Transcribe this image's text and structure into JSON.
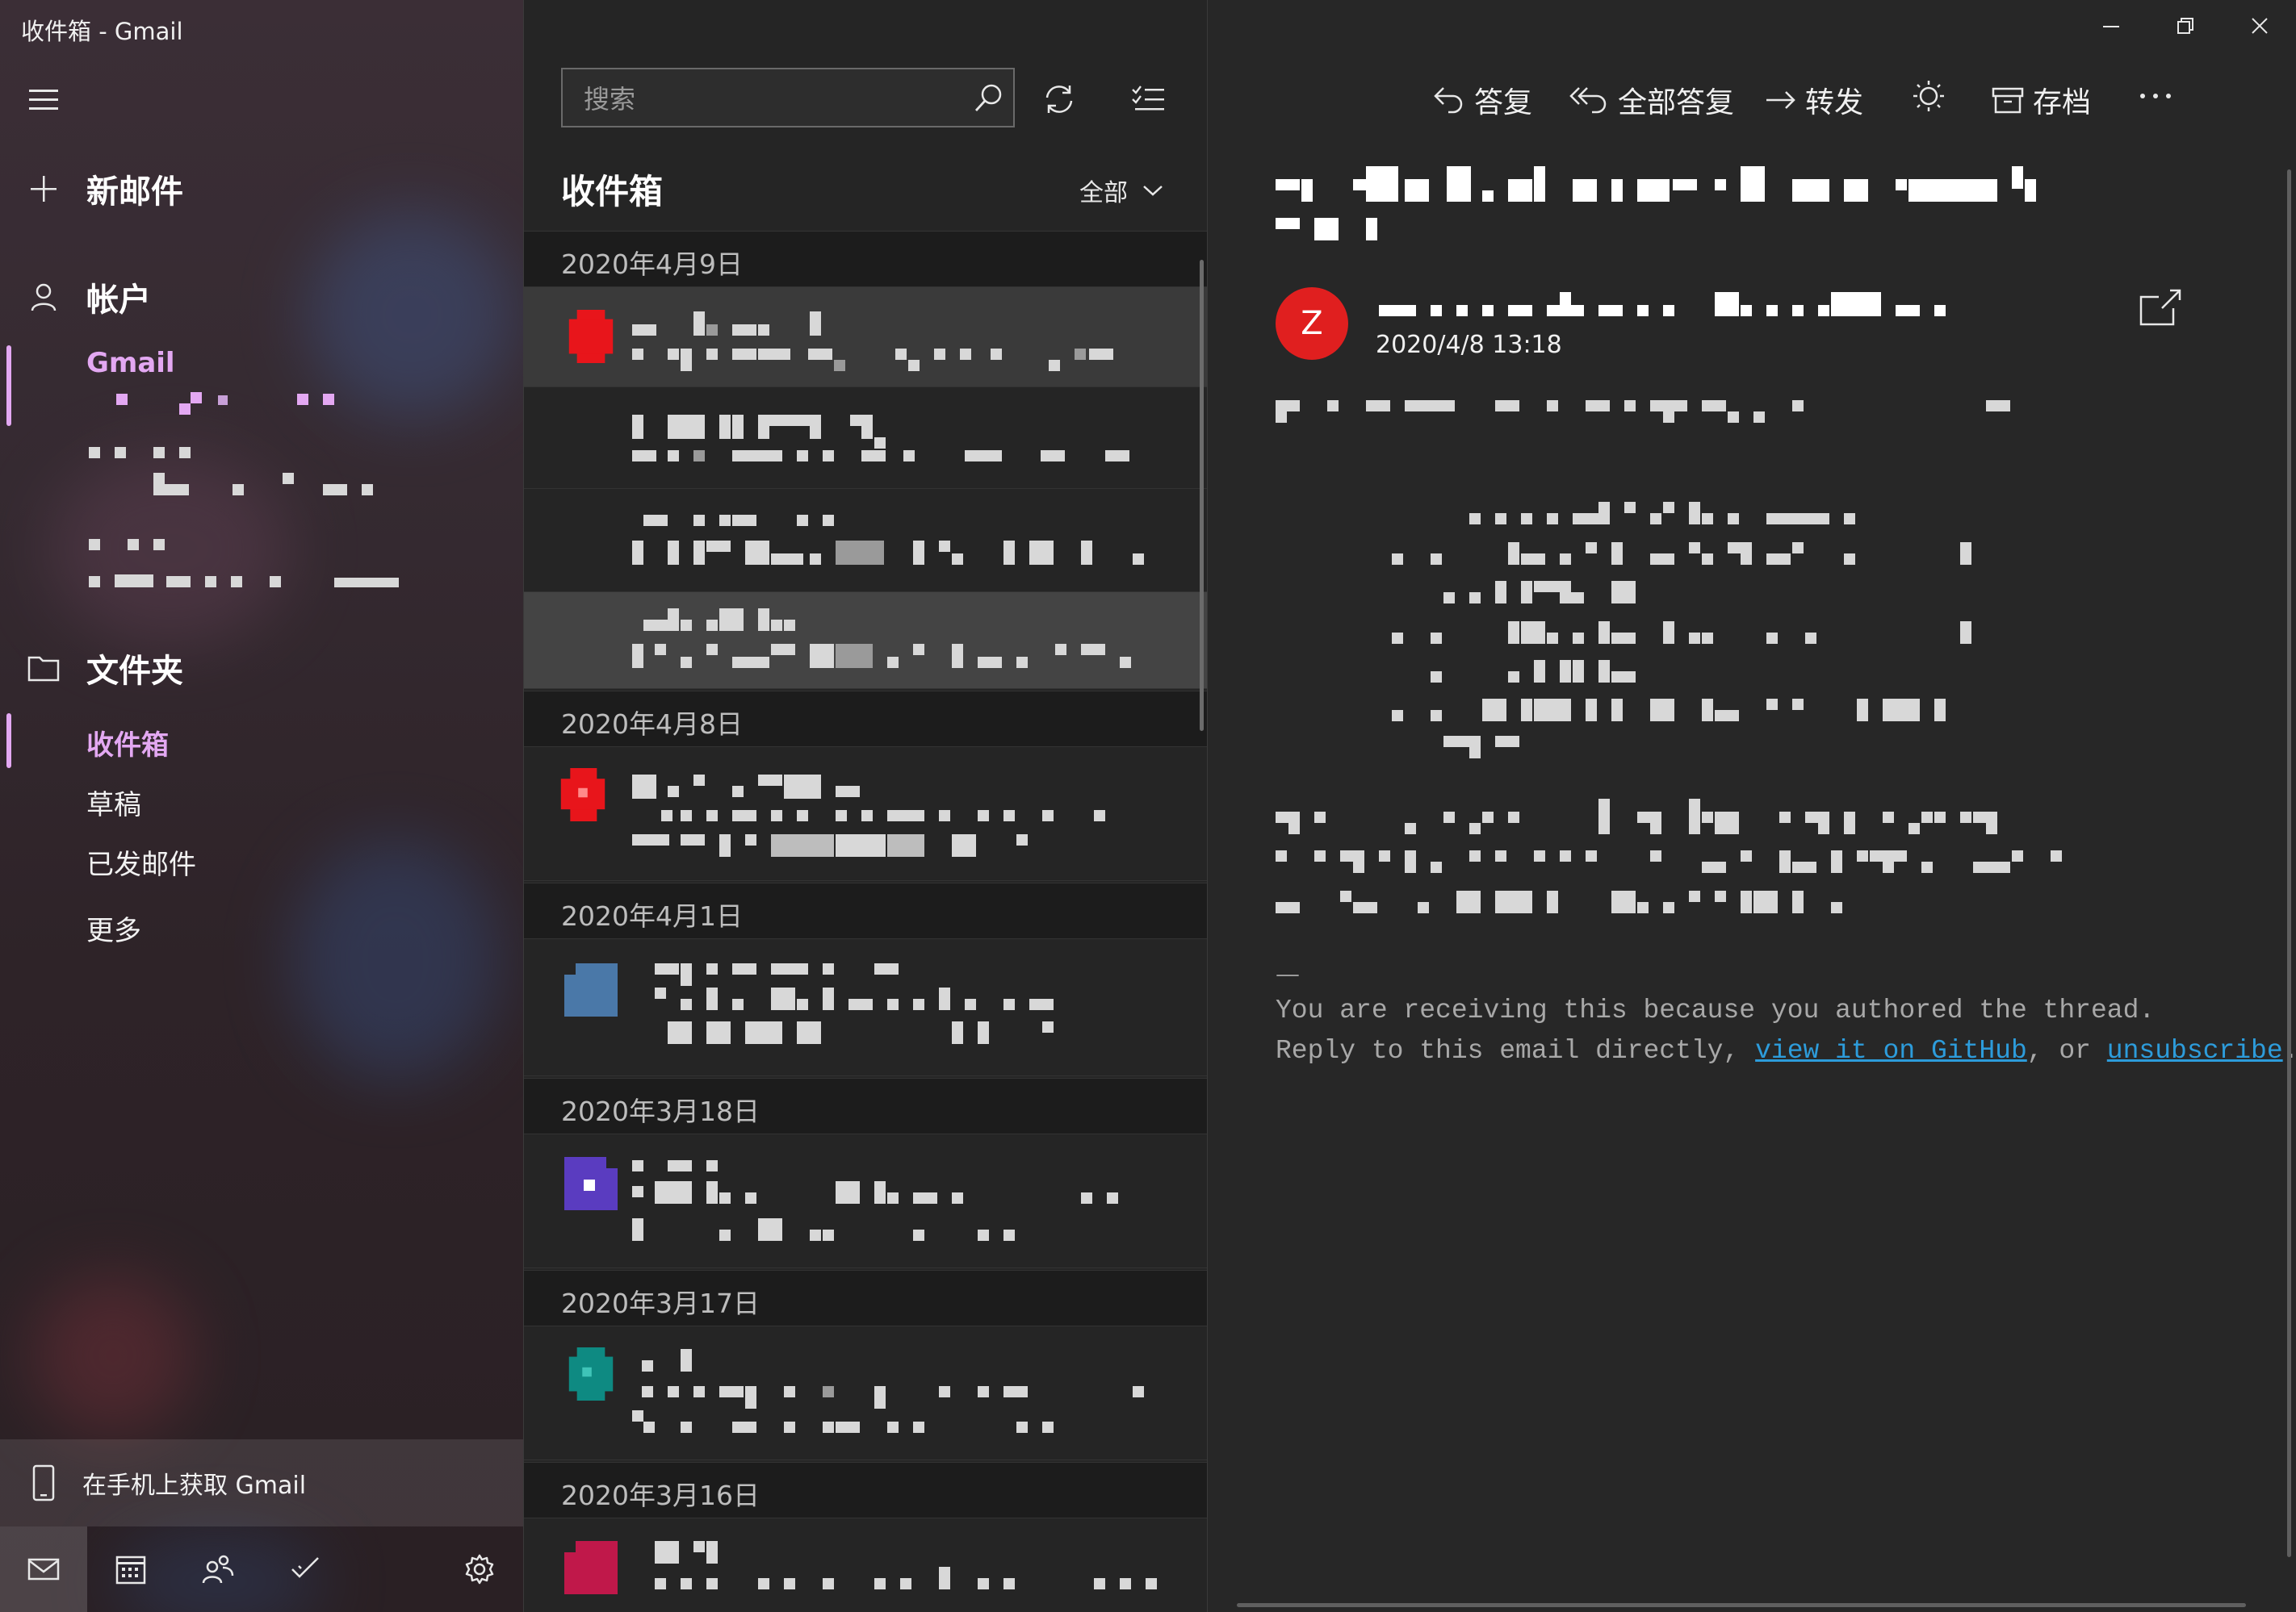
{
  "window": {
    "title": "收件箱 - Gmail"
  },
  "nav": {
    "new_mail": "新邮件",
    "accounts_header": "帐户",
    "account_name": "Gmail",
    "folders_header": "文件夹",
    "folders": [
      {
        "label": "收件箱",
        "active": true
      },
      {
        "label": "草稿",
        "active": false
      },
      {
        "label": "已发邮件",
        "active": false
      },
      {
        "label": "更多",
        "active": false
      }
    ],
    "promo": "在手机上获取 Gmail",
    "accent_color": "#e3a8f2"
  },
  "list": {
    "search_placeholder": "搜索",
    "title": "收件箱",
    "filter": "全部",
    "groups": [
      {
        "date": "2020年4月9日",
        "avatar_color": "#e8151b"
      },
      {
        "date": "2020年4月8日",
        "avatar_color": "#e8151b"
      },
      {
        "date": "2020年4月1日",
        "avatar_color": "#4a78a8"
      },
      {
        "date": "2020年3月18日",
        "avatar_color": "#5a3cc0"
      },
      {
        "date": "2020年3月17日",
        "avatar_color": "#0e8a82"
      },
      {
        "date": "2020年3月16日",
        "avatar_color": "#c0184a"
      }
    ]
  },
  "reader": {
    "actions": {
      "reply": "答复",
      "reply_all": "全部答复",
      "forward": "转发",
      "archive": "存档"
    },
    "sender_initial": "Z",
    "sent_date": "2020/4/8 13:18",
    "separator": "—",
    "footer_line1": "You are receiving this because you authored the thread.",
    "footer_line2_prefix": "Reply to this email directly, ",
    "footer_link1": "view it on GitHub",
    "footer_mid": ", or ",
    "footer_link2": "unsubscribe",
    "footer_suffix": ".."
  }
}
